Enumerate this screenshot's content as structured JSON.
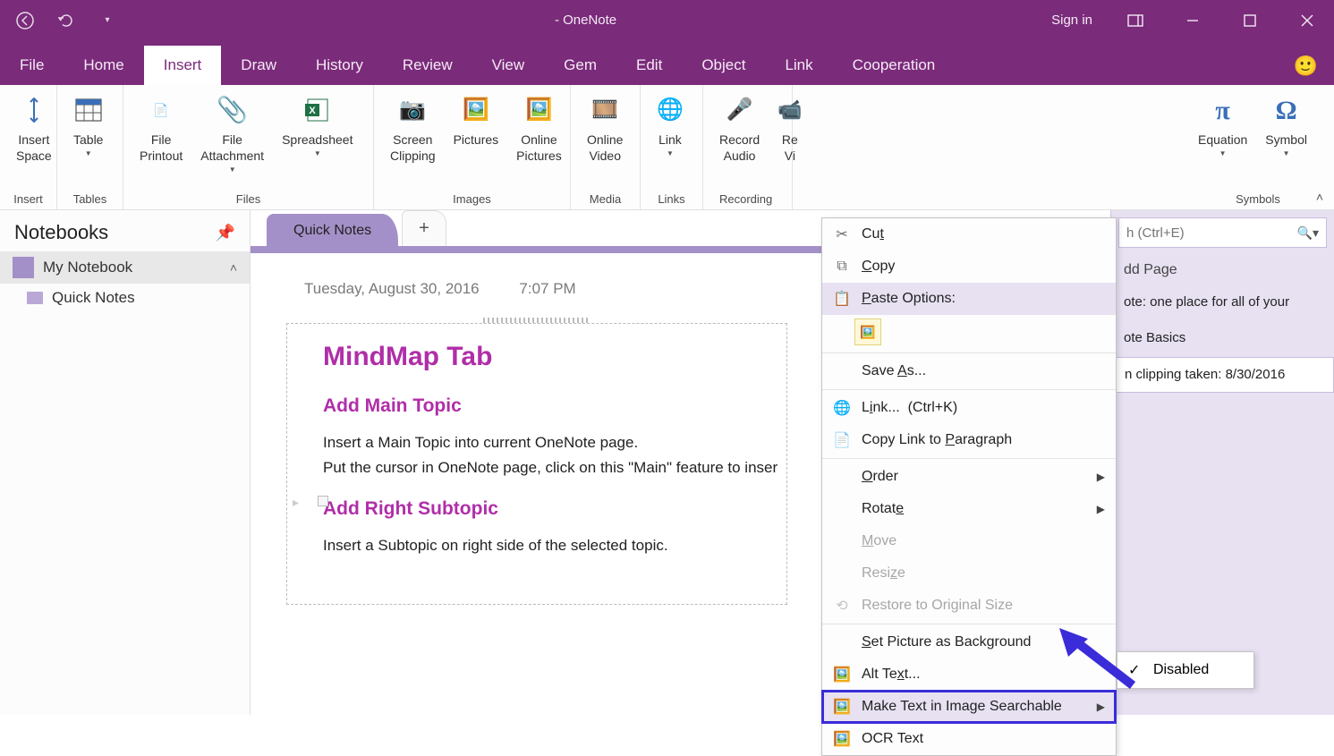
{
  "titlebar": {
    "title": "- OneNote",
    "signin": "Sign in"
  },
  "menu": {
    "items": [
      "File",
      "Home",
      "Insert",
      "Draw",
      "History",
      "Review",
      "View",
      "Gem",
      "Edit",
      "Object",
      "Link",
      "Cooperation"
    ],
    "active_index": 2
  },
  "ribbon": {
    "groups": [
      {
        "label": "Insert",
        "buttons": [
          {
            "name": "insert-space",
            "label": "Insert\nSpace"
          }
        ]
      },
      {
        "label": "Tables",
        "buttons": [
          {
            "name": "table",
            "label": "Table",
            "dropdown": true
          }
        ]
      },
      {
        "label": "Files",
        "buttons": [
          {
            "name": "file-printout",
            "label": "File\nPrintout"
          },
          {
            "name": "file-attachment",
            "label": "File\nAttachment",
            "dropdown": true
          },
          {
            "name": "spreadsheet",
            "label": "Spreadsheet",
            "dropdown": true
          }
        ]
      },
      {
        "label": "Images",
        "buttons": [
          {
            "name": "screen-clipping",
            "label": "Screen\nClipping"
          },
          {
            "name": "pictures",
            "label": "Pictures"
          },
          {
            "name": "online-pictures",
            "label": "Online\nPictures"
          }
        ]
      },
      {
        "label": "Media",
        "buttons": [
          {
            "name": "online-video",
            "label": "Online\nVideo"
          }
        ]
      },
      {
        "label": "Links",
        "buttons": [
          {
            "name": "link",
            "label": "Link",
            "dropdown": true
          }
        ]
      },
      {
        "label": "Recording",
        "buttons": [
          {
            "name": "record-audio",
            "label": "Record\nAudio"
          },
          {
            "name": "record-video",
            "label": "Re\nVi"
          }
        ]
      },
      {
        "label": "Symbols",
        "buttons": [
          {
            "name": "equation",
            "label": "Equation",
            "dropdown": true
          },
          {
            "name": "symbol",
            "label": "Symbol",
            "dropdown": true
          }
        ]
      }
    ]
  },
  "left_panel": {
    "title": "Notebooks",
    "notebook": "My Notebook",
    "section": "Quick Notes"
  },
  "tabs": {
    "items": [
      "Quick Notes"
    ],
    "active_index": 0
  },
  "page": {
    "date": "Tuesday, August 30, 2016",
    "time": "7:07 PM",
    "h1": "MindMap Tab",
    "h2a": "Add Main Topic",
    "body1_l1": "Insert a Main Topic into current OneNote page.",
    "body1_l2": "Put the cursor in OneNote page, click on this \"Main\" feature to inser",
    "h2b": "Add Right Subtopic",
    "body2": "Insert a Subtopic on right side of the selected topic."
  },
  "right_panel": {
    "search_placeholder": "h (Ctrl+E)",
    "add_page": "dd Page",
    "pages": [
      "ote: one place for all of your",
      "ote Basics",
      "n clipping taken: 8/30/2016"
    ],
    "selected_index": 2
  },
  "context_menu": {
    "cut": "Cut",
    "copy": "Copy",
    "paste_options": "Paste Options:",
    "save_as": "Save As...",
    "link": "Link...  (Ctrl+K)",
    "copy_link_para": "Copy Link to Paragraph",
    "order": "Order",
    "rotate": "Rotate",
    "move": "Move",
    "resize": "Resize",
    "restore": "Restore to Original Size",
    "set_bg": "Set Picture as Background",
    "alt_text": "Alt Text...",
    "make_searchable": "Make Text in Image Searchable",
    "ocr": "OCR Text"
  },
  "submenu": {
    "disabled": "Disabled"
  }
}
